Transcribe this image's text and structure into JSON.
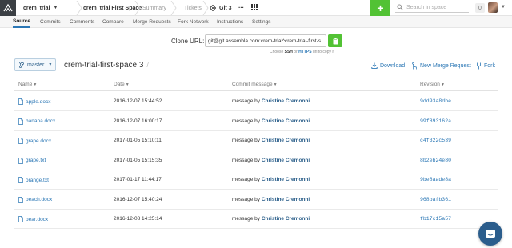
{
  "topbar": {
    "org": "crem_trial",
    "space": "crem_trial First Space",
    "nav": [
      "Summary",
      "Tickets"
    ],
    "git_tab": "Git 3",
    "more": "...",
    "plus": "+",
    "search_placeholder": "Search in space",
    "notif_count": "0"
  },
  "subnav": {
    "tabs": [
      "Source",
      "Commits",
      "Comments",
      "Compare",
      "Merge Requests",
      "Fork Network",
      "Instructions",
      "Settings"
    ],
    "active": "Source"
  },
  "clone": {
    "label": "Clone URL:",
    "url": "git@git.assembla.com:crem-trial^crem-trial-first-s",
    "hint_prefix": "Choose",
    "hint_ssh": "SSH",
    "hint_or": "or",
    "hint_https": "HTTPS",
    "hint_suffix": "url to copy it"
  },
  "repo": {
    "branch": "master",
    "title": "crem-trial-first-space.3",
    "slash": "/",
    "actions": {
      "download": "Download",
      "merge": "New Merge Request",
      "fork": "Fork"
    }
  },
  "table": {
    "headers": {
      "name": "Name",
      "date": "Date",
      "message": "Commit message",
      "revision": "Revision"
    },
    "rows": [
      {
        "name": "apple.docx",
        "date": "2016-12-07 15:44:52",
        "msg_prefix": "message by",
        "author": "Christine Cremonni",
        "rev": "9dd93a8dbe"
      },
      {
        "name": "banana.docx",
        "date": "2016-12-07 16:00:17",
        "msg_prefix": "message by",
        "author": "Christine Cremonni",
        "rev": "99f893162a"
      },
      {
        "name": "grape.docx",
        "date": "2017-01-05 15:10:11",
        "msg_prefix": "message by",
        "author": "Christine Cremonni",
        "rev": "c4f322c539"
      },
      {
        "name": "grape.txt",
        "date": "2017-01-05 15:15:35",
        "msg_prefix": "message by",
        "author": "Christine Cremonni",
        "rev": "8b2eb24e80"
      },
      {
        "name": "orange.txt",
        "date": "2017-01-17 11:44:17",
        "msg_prefix": "message by",
        "author": "Christine Cremonni",
        "rev": "9be8aade8a"
      },
      {
        "name": "peach.docx",
        "date": "2016-12-07 15:40:24",
        "msg_prefix": "message by",
        "author": "Christine Cremonni",
        "rev": "968bafb361"
      },
      {
        "name": "pear.docx",
        "date": "2016-12-08 14:25:14",
        "msg_prefix": "message by",
        "author": "Christine Cremonni",
        "rev": "fb17c15a57"
      }
    ]
  },
  "colors": {
    "accent_green": "#52c234",
    "link_blue": "#2b77b5",
    "chat_blue": "#2b5d8c"
  }
}
